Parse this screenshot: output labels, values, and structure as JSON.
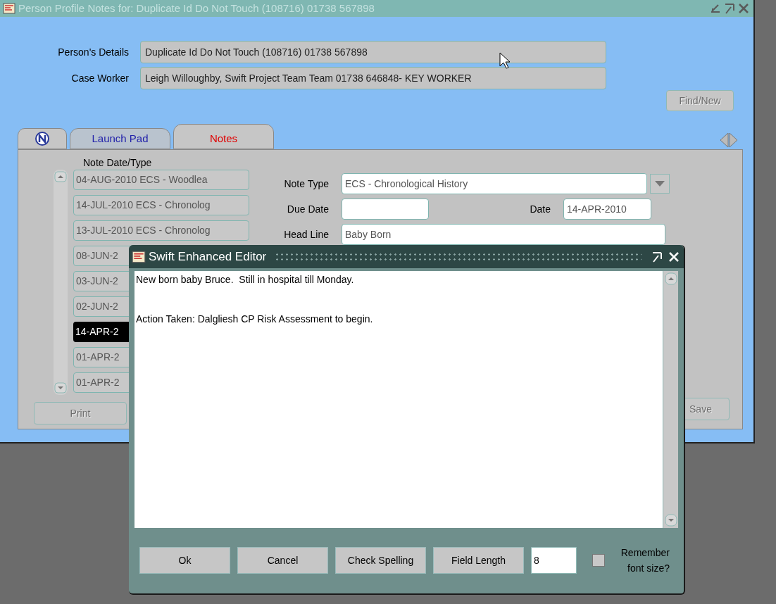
{
  "window": {
    "title": "Person Profile Notes for:  Duplicate Id Do Not Touch (108716) 01738 567898"
  },
  "header_fields": [
    {
      "label": "Person's Details",
      "value": "Duplicate Id Do Not Touch (108716) 01738 567898"
    },
    {
      "label": "Case Worker",
      "value": "Leigh Willoughby, Swift Project Team Team 01738 646848- KEY WORKER"
    }
  ],
  "find_button": {
    "label": "Find/New",
    "disabled": true
  },
  "tabs": [
    {
      "label": "Launch Pad",
      "selected": false
    },
    {
      "label": "Notes",
      "selected": true
    }
  ],
  "notes_list": {
    "heading": "Note Date/Type",
    "items": [
      {
        "text": "04-AUG-2010 ECS - Woodlea",
        "selected": false
      },
      {
        "text": "14-JUL-2010 ECS - Chronolog",
        "selected": false
      },
      {
        "text": "13-JUL-2010 ECS - Chronolog",
        "selected": false
      },
      {
        "text": "08-JUN-2",
        "selected": false
      },
      {
        "text": "03-JUN-2",
        "selected": false
      },
      {
        "text": "02-JUN-2",
        "selected": false
      },
      {
        "text": "14-APR-2",
        "selected": true
      },
      {
        "text": "01-APR-2",
        "selected": false
      },
      {
        "text": "01-APR-2",
        "selected": false
      }
    ]
  },
  "note_form": {
    "note_type": {
      "label": "Note Type",
      "value": "ECS - Chronological History"
    },
    "due_date": {
      "label": "Due Date"
    },
    "date": {
      "label": "Date",
      "value": "14-APR-2010"
    },
    "head_line": {
      "label": "Head Line",
      "value": "Baby Born"
    }
  },
  "bottom_buttons": [
    {
      "label": "Print",
      "disabled": true
    },
    {
      "label": "Save",
      "disabled": true
    }
  ],
  "editor": {
    "title": "Swift Enhanced Editor",
    "paragraphs": [
      "New born baby Bruce.  Still in hospital till Monday.",
      "Action Taken: Dalgliesh CP Risk Assessment to begin."
    ],
    "buttons": [
      "Ok",
      "Cancel",
      "Check Spelling",
      "Field Length"
    ],
    "font_size": "8",
    "remember": {
      "label": "Remember font size?",
      "checked": false
    }
  }
}
